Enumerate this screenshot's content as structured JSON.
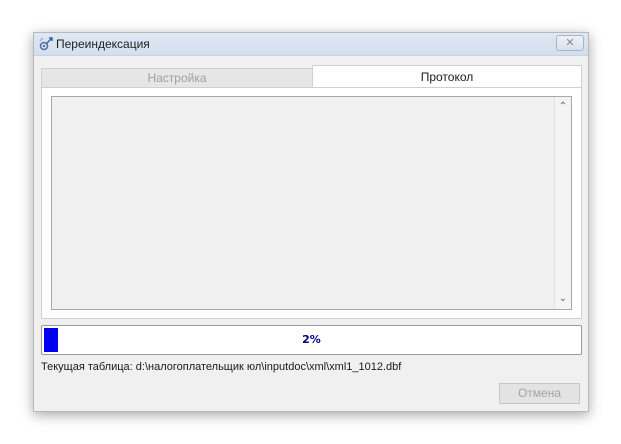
{
  "window": {
    "title": "Переиндексация",
    "icon": "reindex-gear-icon",
    "close_icon": "close-icon",
    "close_glyph": "✕"
  },
  "tabs": [
    {
      "label": "Настройка",
      "active": false,
      "enabled": false
    },
    {
      "label": "Протокол",
      "active": true,
      "enabled": true
    }
  ],
  "log": {
    "lines": [],
    "scroll_up_glyph": "⌃",
    "scroll_down_glyph": "⌄"
  },
  "progress": {
    "value": 0.02,
    "label": "2%",
    "fill_color": "#0000ee",
    "text_color": "#00008b"
  },
  "status": {
    "current_table": "Текущая таблица: d:\\налогоплательщик юл\\inputdoc\\xml\\xml1_1012.dbf"
  },
  "buttons": {
    "cancel_label": "Отмена",
    "cancel_enabled": false
  }
}
